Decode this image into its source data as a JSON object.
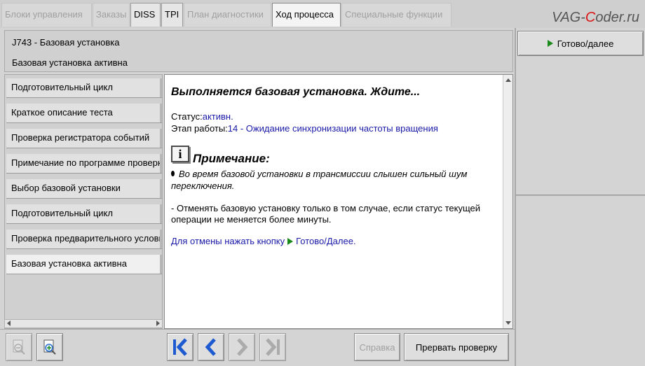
{
  "tabs": [
    {
      "label": "Блоки управления",
      "state": "disabled"
    },
    {
      "label": "Заказы",
      "state": "disabled"
    },
    {
      "label": "DISS",
      "state": "enabled"
    },
    {
      "label": "TPI",
      "state": "enabled"
    },
    {
      "label": "План диагностики",
      "state": "disabled"
    },
    {
      "label": "Ход процесса",
      "state": "active"
    },
    {
      "label": "Специальные функции",
      "state": "disabled"
    }
  ],
  "brand": {
    "prefix": "VAG-",
    "accent": "C",
    "suffix": "oder.ru"
  },
  "header": {
    "line1": "J743 - Базовая установка",
    "line2": "Базовая установка активна"
  },
  "right_panel": {
    "ready_button": "Готово/далее"
  },
  "steps": [
    "Подготовительный цикл",
    "Краткое описание теста",
    "Проверка регистратора событий",
    "Примечание по программе проверки",
    "Выбор базовой установки",
    "Подготовительный цикл",
    "Проверка предварительного условия",
    "Базовая установка активна"
  ],
  "content": {
    "title": "Выполняется базовая установка. Ждите...",
    "status_label": "Статус:",
    "status_value": "активн.",
    "stage_label": "Этап работы:",
    "stage_value": "14 - Ожидание синхронизации частоты вращения",
    "note_icon": "i",
    "note_heading": "Примечание:",
    "note_bullet": "Во время базовой установки в трансмиссии слышен сильный шум переключения.",
    "note_text": "- Отменять базовую установку только в том случае, если статус текущей операции не меняется более минуты.",
    "cancel_hint_prefix": "Для отмены нажать кнопку",
    "cancel_hint_suffix": "Готово/Далее."
  },
  "toolbar": {
    "help_label": "Справка",
    "abort_label": "Прервать проверку"
  },
  "colors": {
    "play_green": "#1a8a1a",
    "link_blue": "#1a1aa8",
    "nav_blue": "#1f5bd0",
    "nav_disabled": "#9a9a9a"
  }
}
